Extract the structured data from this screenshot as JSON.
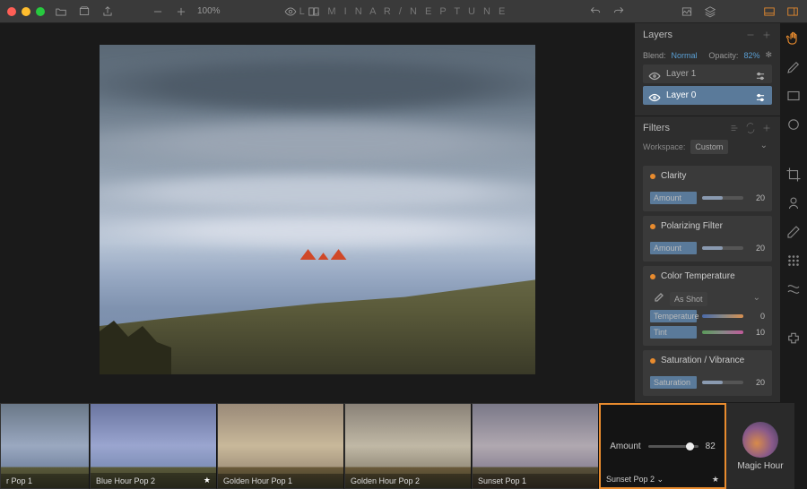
{
  "app_title": "L U M I N A R / N E P T U N E",
  "zoom": "100%",
  "panel": {
    "layers": {
      "title": "Layers",
      "blend_label": "Blend:",
      "blend_value": "Normal",
      "opacity_label": "Opacity:",
      "opacity_value": "82%",
      "items": [
        {
          "name": "Layer 1"
        },
        {
          "name": "Layer 0"
        }
      ]
    },
    "filters": {
      "title": "Filters",
      "workspace_label": "Workspace:",
      "workspace_value": "Custom",
      "items": [
        {
          "name": "Clarity",
          "sliders": [
            {
              "label": "Amount",
              "value": 20
            }
          ]
        },
        {
          "name": "Polarizing Filter",
          "sliders": [
            {
              "label": "Amount",
              "value": 20
            }
          ]
        },
        {
          "name": "Color Temperature",
          "preset": "As Shot",
          "sliders": [
            {
              "label": "Temperature",
              "value": 0,
              "grad": "temp"
            },
            {
              "label": "Tint",
              "value": 10,
              "grad": "tint"
            }
          ]
        },
        {
          "name": "Saturation / Vibrance",
          "sliders": [
            {
              "label": "Saturation",
              "value": 20
            }
          ]
        }
      ]
    }
  },
  "filmstrip": {
    "amount_label": "Amount",
    "amount_value": 82,
    "category": "Magic Hour",
    "presets": [
      {
        "name": "r Pop 1",
        "starred": false,
        "tone": "sky0"
      },
      {
        "name": "Blue Hour Pop 2",
        "starred": true,
        "tone": "sky1"
      },
      {
        "name": "Golden Hour Pop 1",
        "starred": false,
        "tone": "sky2"
      },
      {
        "name": "Golden Hour Pop 2",
        "starred": false,
        "tone": "sky3"
      },
      {
        "name": "Sunset Pop 1",
        "starred": false,
        "tone": "sky4"
      },
      {
        "name": "Sunset Pop 2",
        "starred": true,
        "selected": true
      }
    ]
  }
}
